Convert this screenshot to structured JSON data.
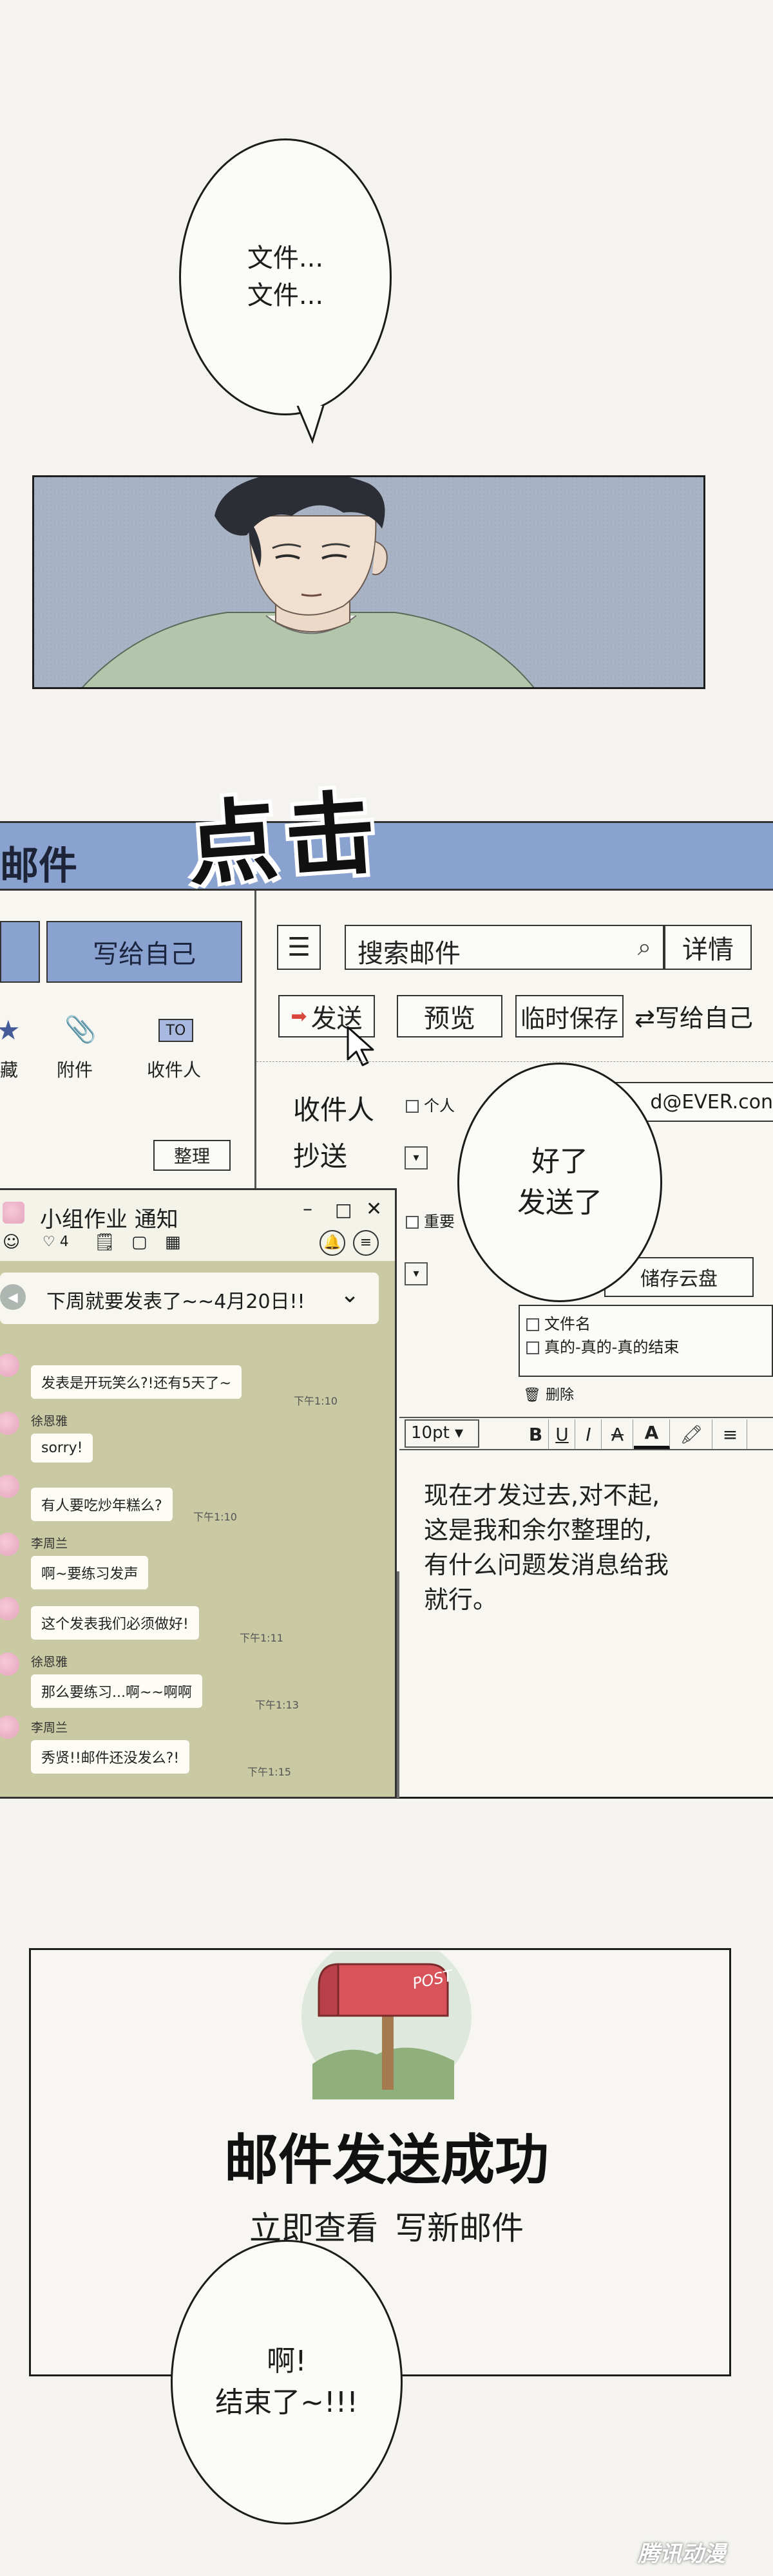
{
  "bubble1": {
    "line1": "文件...",
    "line2": "文件..."
  },
  "sfx_click": "点击",
  "mail_header": {
    "title": "邮件"
  },
  "sidebar": {
    "write_self_button": "写给自己",
    "icons": [
      {
        "label": "藏",
        "icon": "star-icon"
      },
      {
        "label": "附件",
        "icon": "paperclip-icon"
      },
      {
        "label": "收件人",
        "icon": "to-badge-icon",
        "badge": "TO"
      }
    ],
    "organize_button": "整理"
  },
  "toolbar": {
    "search_placeholder": "搜索邮件",
    "details_button": "详情",
    "send_button": "发送",
    "preview_button": "预览",
    "save_draft_button": "临时保存",
    "write_self_button": "写给自己"
  },
  "form": {
    "recipient_label": "收件人",
    "personal_label": "个人",
    "recipient_value": "d@EVER.con",
    "cc_label": "抄送",
    "important_label": "重要",
    "cloud_button": "储存云盘",
    "attachments": [
      "文件名",
      "真的-真的-真的结束"
    ],
    "delete_label": "删除"
  },
  "editor": {
    "font_size": "10pt",
    "bold": "B",
    "underline": "U",
    "italic": "I",
    "strike": "A",
    "color": "A",
    "body_lines": [
      "现在才发过去,对不起,",
      "这是我和余尔整理的,",
      "有什么问题发消息给我",
      "就行。"
    ]
  },
  "bubble2": {
    "line1": "好了",
    "line2": "发送了"
  },
  "chat": {
    "title": "小组作业 通知",
    "likes": "4",
    "pinned": "下周就要发表了~~4月20日!!",
    "messages": [
      {
        "name": "",
        "text": "发表是开玩笑么?!还有5天了~",
        "time": "下午1:10"
      },
      {
        "name": "徐恩雅",
        "text": "sorry!",
        "time": ""
      },
      {
        "name": "",
        "text": "有人要吃炒年糕么?",
        "time": "下午1:10"
      },
      {
        "name": "李周兰",
        "text": "啊~要练习发声",
        "time": ""
      },
      {
        "name": "",
        "text": "这个发表我们必须做好!",
        "time": "下午1:11"
      },
      {
        "name": "徐恩雅",
        "text": "那么要练习...啊~~啊啊",
        "time": "下午1:13"
      },
      {
        "name": "李周兰",
        "text": "秀贤!!邮件还没发么?!",
        "time": "下午1:15"
      }
    ]
  },
  "success": {
    "stamp_text": "POST",
    "title": "邮件发送成功",
    "view_link": "立即查看",
    "new_link": "写新邮件"
  },
  "bubble3": {
    "line1": "啊!",
    "line2": "结束了~!!!"
  },
  "watermark": "腾讯动漫",
  "colors": {
    "mail_blue": "#7f99c9",
    "chat_green": "#c8caa0",
    "paper": "#f4f3ef",
    "send_red": "#d9473c"
  }
}
